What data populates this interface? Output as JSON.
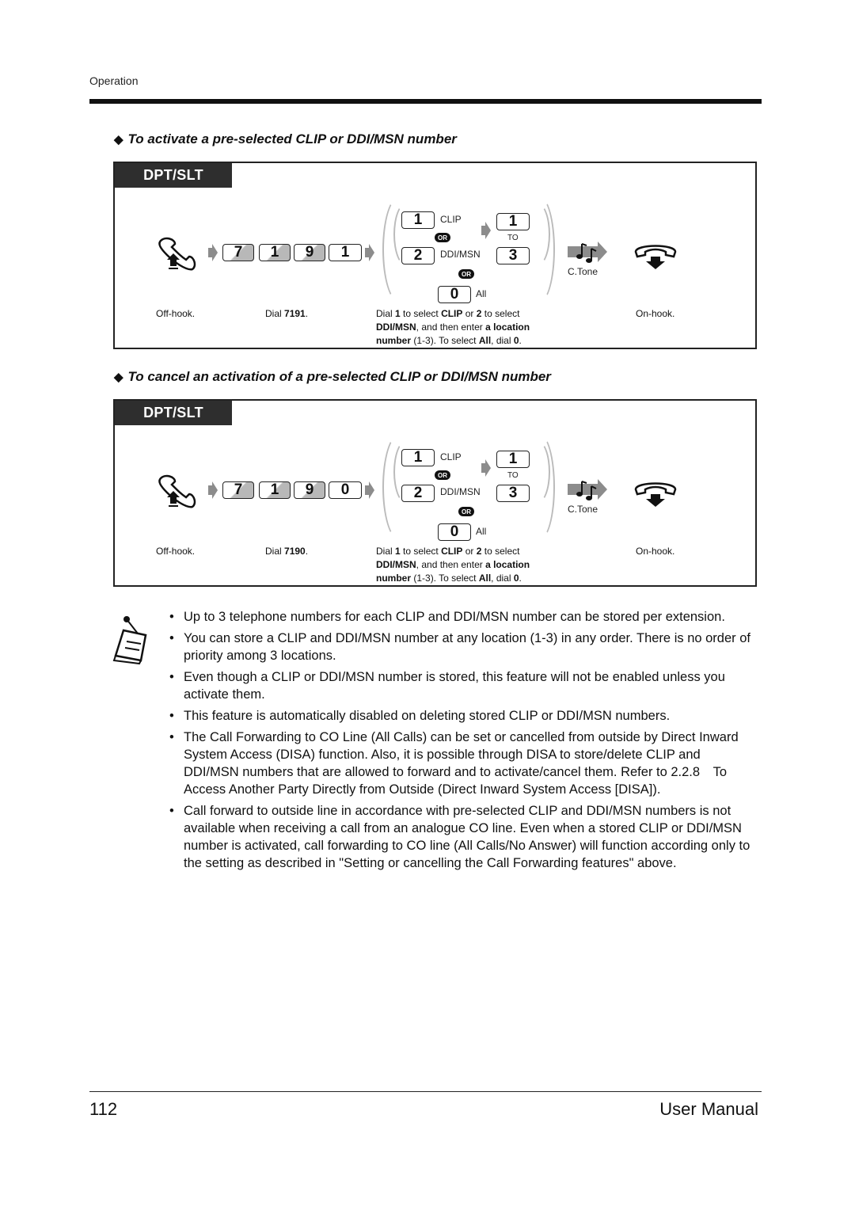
{
  "header": {
    "running_head": "Operation"
  },
  "sections": [
    {
      "heading": "To activate a pre-selected CLIP or DDI/MSN number",
      "tab_label": "DPT/SLT",
      "dial_keys": [
        "7",
        "1",
        "9",
        "1"
      ],
      "select_keys": {
        "clip_key": "1",
        "clip_label": "CLIP",
        "ddi_key": "2",
        "ddi_label": "DDI/MSN",
        "or_label": "OR",
        "loc_from": "1",
        "to_label": "TO",
        "loc_to": "3",
        "all_key": "0",
        "all_label": "All"
      },
      "tone_label": "C.Tone",
      "captions": {
        "off_hook": "Off-hook.",
        "dial_prefix": "Dial ",
        "dial_code": "7191",
        "dial_suffix": ".",
        "select_parts": [
          "Dial ",
          "1",
          " to select ",
          "CLIP",
          " or ",
          "2",
          " to select ",
          "DDI/MSN",
          ", and then enter ",
          "a location number",
          " (1-3). To select ",
          "All",
          ", dial ",
          "0",
          "."
        ],
        "on_hook": "On-hook."
      }
    },
    {
      "heading": "To cancel an activation of a pre-selected CLIP or DDI/MSN number",
      "tab_label": "DPT/SLT",
      "dial_keys": [
        "7",
        "1",
        "9",
        "0"
      ],
      "select_keys": {
        "clip_key": "1",
        "clip_label": "CLIP",
        "ddi_key": "2",
        "ddi_label": "DDI/MSN",
        "or_label": "OR",
        "loc_from": "1",
        "to_label": "TO",
        "loc_to": "3",
        "all_key": "0",
        "all_label": "All"
      },
      "tone_label": "C.Tone",
      "captions": {
        "off_hook": "Off-hook.",
        "dial_prefix": "Dial ",
        "dial_code": "7190",
        "dial_suffix": ".",
        "select_parts": [
          "Dial ",
          "1",
          " to select ",
          "CLIP",
          " or ",
          "2",
          " to select ",
          "DDI/MSN",
          ", and then enter ",
          "a location number",
          " (1-3). To select ",
          "All",
          ", dial ",
          "0",
          "."
        ],
        "on_hook": "On-hook."
      }
    }
  ],
  "notes": [
    "Up to 3 telephone numbers for each CLIP and DDI/MSN number can be stored per extension.",
    "You can store a CLIP and DDI/MSN number at any location (1-3) in any order. There is no order of priority among 3 locations.",
    "Even though a CLIP or DDI/MSN number is stored, this feature will not be enabled unless you activate them.",
    "This feature is automatically disabled on deleting stored CLIP or DDI/MSN numbers.",
    "The Call Forwarding to CO Line (All Calls) can be set or cancelled from outside by Direct Inward System Access (DISA) function. Also, it is possible through DISA to store/delete CLIP and DDI/MSN numbers that are allowed to forward and to activate/cancel them. Refer to 2.2.8 To Access Another Party Directly from Outside (Direct Inward System Access [DISA]).",
    "Call forward to outside line in accordance with pre-selected CLIP and DDI/MSN numbers is not available when receiving a call from an analogue CO line. Even when a stored CLIP or DDI/MSN number is activated, call forwarding to CO line (All Calls/No Answer) will function according only to the setting as described in \"Setting or cancelling the Call Forwarding features\" above."
  ],
  "footer": {
    "page_number": "112",
    "doc_title": "User Manual"
  },
  "colors": {
    "tab_bg": "#2e2e2e",
    "key_shade": "#b8b8b8",
    "arrow_gray": "#8c8c8c",
    "paren_gray": "#bbbbbb"
  }
}
